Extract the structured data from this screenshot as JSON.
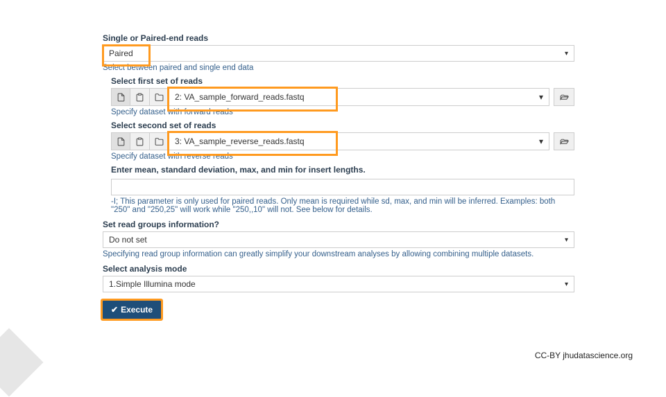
{
  "single_paired": {
    "label": "Single or Paired-end reads",
    "value": "Paired",
    "help": "Select between paired and single end data"
  },
  "first_set": {
    "label": "Select first set of reads",
    "value": "2: VA_sample_forward_reads.fastq",
    "help": "Specify dataset with forward reads"
  },
  "second_set": {
    "label": "Select second set of reads",
    "value": "3: VA_sample_reverse_reads.fastq",
    "help": "Specify dataset with reverse reads"
  },
  "insert": {
    "label": "Enter mean, standard deviation, max, and min for insert lengths.",
    "value": "",
    "help": "-I; This parameter is only used for paired reads. Only mean is required while sd, max, and min will be inferred. Examples: both \"250\" and \"250,25\" will work while \"250,,10\" will not. See below for details."
  },
  "read_groups": {
    "label": "Set read groups information?",
    "value": "Do not set",
    "help": "Specifying read group information can greatly simplify your downstream analyses by allowing combining multiple datasets."
  },
  "analysis_mode": {
    "label": "Select analysis mode",
    "value": "1.Simple Illumina mode"
  },
  "execute": {
    "label": "Execute"
  },
  "credit": "CC-BY  jhudatascience.org"
}
